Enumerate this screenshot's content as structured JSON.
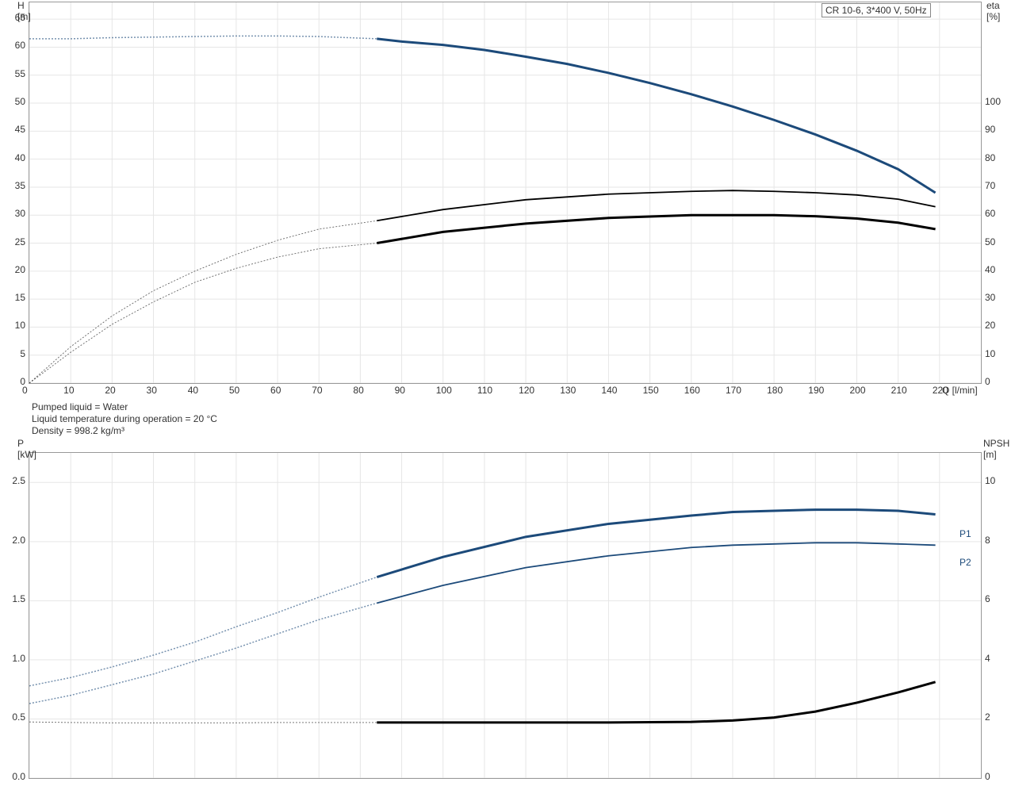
{
  "legend": {
    "label": "CR 10-6, 3*400 V, 50Hz"
  },
  "notes": {
    "line1": "Pumped liquid = Water",
    "line2": "Liquid temperature during operation = 20 °C",
    "line3": "Density = 998.2 kg/m³"
  },
  "series_tags": {
    "p1": "P1",
    "p2": "P2"
  },
  "chart_top": {
    "axes": {
      "x": {
        "label": "Q [l/min]",
        "min": 0,
        "max": 230,
        "ticks": [
          0,
          10,
          20,
          30,
          40,
          50,
          60,
          70,
          80,
          90,
          100,
          110,
          120,
          130,
          140,
          150,
          160,
          170,
          180,
          190,
          200,
          210,
          220
        ]
      },
      "y_left": {
        "label_line1": "H",
        "label_line2": "[m]",
        "min": 0,
        "max": 68,
        "ticks": [
          0,
          5,
          10,
          15,
          20,
          25,
          30,
          35,
          40,
          45,
          50,
          55,
          60,
          65
        ]
      },
      "y_right": {
        "label_line1": "eta",
        "label_line2": "[%]",
        "min": 0,
        "max": 136,
        "ticks": [
          0,
          10,
          20,
          30,
          40,
          50,
          60,
          70,
          80,
          90,
          100
        ]
      }
    }
  },
  "chart_bottom": {
    "axes": {
      "x": {
        "label": "",
        "min": 0,
        "max": 230,
        "ticks": []
      },
      "y_left": {
        "label_line1": "P",
        "label_line2": "[kW]",
        "min": 0,
        "max": 2.75,
        "ticks": [
          0.0,
          0.5,
          1.0,
          1.5,
          2.0,
          2.5
        ]
      },
      "y_right": {
        "label_line1": "NPSH",
        "label_line2": "[m]",
        "min": 0,
        "max": 11,
        "ticks": [
          0,
          2,
          4,
          6,
          8,
          10
        ]
      }
    }
  },
  "chart_data": [
    {
      "id": "top",
      "type": "line",
      "xlabel": "Q [l/min]",
      "ylabel_left": "H [m]",
      "ylabel_right": "eta [%]",
      "xlim": [
        0,
        230
      ],
      "ylim_left": [
        0,
        68
      ],
      "ylim_right": [
        0,
        136
      ],
      "title": "",
      "series": [
        {
          "name": "H full",
          "axis": "left",
          "style": "blue-ghost",
          "x": [
            0,
            10,
            20,
            30,
            40,
            50,
            60,
            70,
            84
          ],
          "y": [
            61.5,
            61.5,
            61.7,
            61.8,
            61.9,
            62.0,
            62.0,
            61.9,
            61.5
          ]
        },
        {
          "name": "H duty",
          "axis": "left",
          "style": "blue",
          "x": [
            84,
            90,
            100,
            110,
            120,
            130,
            140,
            150,
            160,
            170,
            180,
            190,
            200,
            210,
            219
          ],
          "y": [
            61.5,
            61.0,
            60.4,
            59.5,
            58.3,
            57.0,
            55.4,
            53.6,
            51.6,
            49.4,
            47.0,
            44.4,
            41.5,
            38.2,
            34.0
          ]
        },
        {
          "name": "eta1 full",
          "axis": "right",
          "style": "black-ghost",
          "x": [
            0,
            10,
            20,
            30,
            40,
            50,
            60,
            70,
            84
          ],
          "y": [
            0,
            13,
            24,
            33,
            40,
            46,
            51,
            55,
            58
          ]
        },
        {
          "name": "eta1 duty",
          "axis": "right",
          "style": "black-thin",
          "x": [
            84,
            100,
            120,
            140,
            160,
            170,
            180,
            190,
            200,
            210,
            219
          ],
          "y": [
            58,
            62,
            65.5,
            67.5,
            68.5,
            68.8,
            68.5,
            68.0,
            67.2,
            65.7,
            63.0
          ]
        },
        {
          "name": "eta2 full",
          "axis": "right",
          "style": "black-ghost",
          "x": [
            0,
            10,
            20,
            30,
            40,
            50,
            60,
            70,
            84
          ],
          "y": [
            0,
            11,
            21,
            29,
            36,
            41,
            45,
            48,
            50
          ]
        },
        {
          "name": "eta2 duty",
          "axis": "right",
          "style": "black",
          "x": [
            84,
            100,
            120,
            140,
            160,
            170,
            180,
            190,
            200,
            210,
            219
          ],
          "y": [
            50,
            54,
            57,
            59,
            60,
            60,
            60,
            59.6,
            58.8,
            57.3,
            55.0
          ]
        }
      ]
    },
    {
      "id": "bottom",
      "type": "line",
      "xlabel": "Q [l/min]",
      "ylabel_left": "P [kW]",
      "ylabel_right": "NPSH [m]",
      "xlim": [
        0,
        230
      ],
      "ylim_left": [
        0,
        2.75
      ],
      "ylim_right": [
        0,
        11
      ],
      "title": "",
      "series": [
        {
          "name": "P1 full",
          "axis": "left",
          "style": "blue-ghost",
          "x": [
            0,
            10,
            20,
            30,
            40,
            50,
            60,
            70,
            84
          ],
          "y": [
            0.78,
            0.85,
            0.94,
            1.04,
            1.15,
            1.28,
            1.4,
            1.53,
            1.7
          ]
        },
        {
          "name": "P1 duty",
          "axis": "left",
          "style": "blue",
          "x": [
            84,
            100,
            120,
            140,
            160,
            170,
            180,
            190,
            200,
            210,
            219
          ],
          "y": [
            1.7,
            1.87,
            2.04,
            2.15,
            2.22,
            2.25,
            2.26,
            2.27,
            2.27,
            2.26,
            2.23
          ]
        },
        {
          "name": "P2 full",
          "axis": "left",
          "style": "blue-ghost",
          "x": [
            0,
            10,
            20,
            30,
            40,
            50,
            60,
            70,
            84
          ],
          "y": [
            0.63,
            0.7,
            0.79,
            0.88,
            0.99,
            1.1,
            1.22,
            1.34,
            1.48
          ]
        },
        {
          "name": "P2 duty",
          "axis": "left",
          "style": "blue-thin",
          "x": [
            84,
            100,
            120,
            140,
            160,
            170,
            180,
            190,
            200,
            210,
            219
          ],
          "y": [
            1.48,
            1.63,
            1.78,
            1.88,
            1.95,
            1.97,
            1.98,
            1.99,
            1.99,
            1.98,
            1.97
          ]
        },
        {
          "name": "NPSH full",
          "axis": "right",
          "style": "black-ghost",
          "x": [
            0,
            10,
            20,
            30,
            40,
            50,
            60,
            70,
            84
          ],
          "y": [
            1.9,
            1.88,
            1.87,
            1.87,
            1.87,
            1.87,
            1.88,
            1.88,
            1.88
          ]
        },
        {
          "name": "NPSH duty",
          "axis": "right",
          "style": "black",
          "x": [
            84,
            100,
            120,
            140,
            160,
            170,
            180,
            190,
            200,
            210,
            219
          ],
          "y": [
            1.88,
            1.88,
            1.88,
            1.88,
            1.9,
            1.95,
            2.05,
            2.25,
            2.55,
            2.9,
            3.25
          ]
        }
      ]
    }
  ]
}
